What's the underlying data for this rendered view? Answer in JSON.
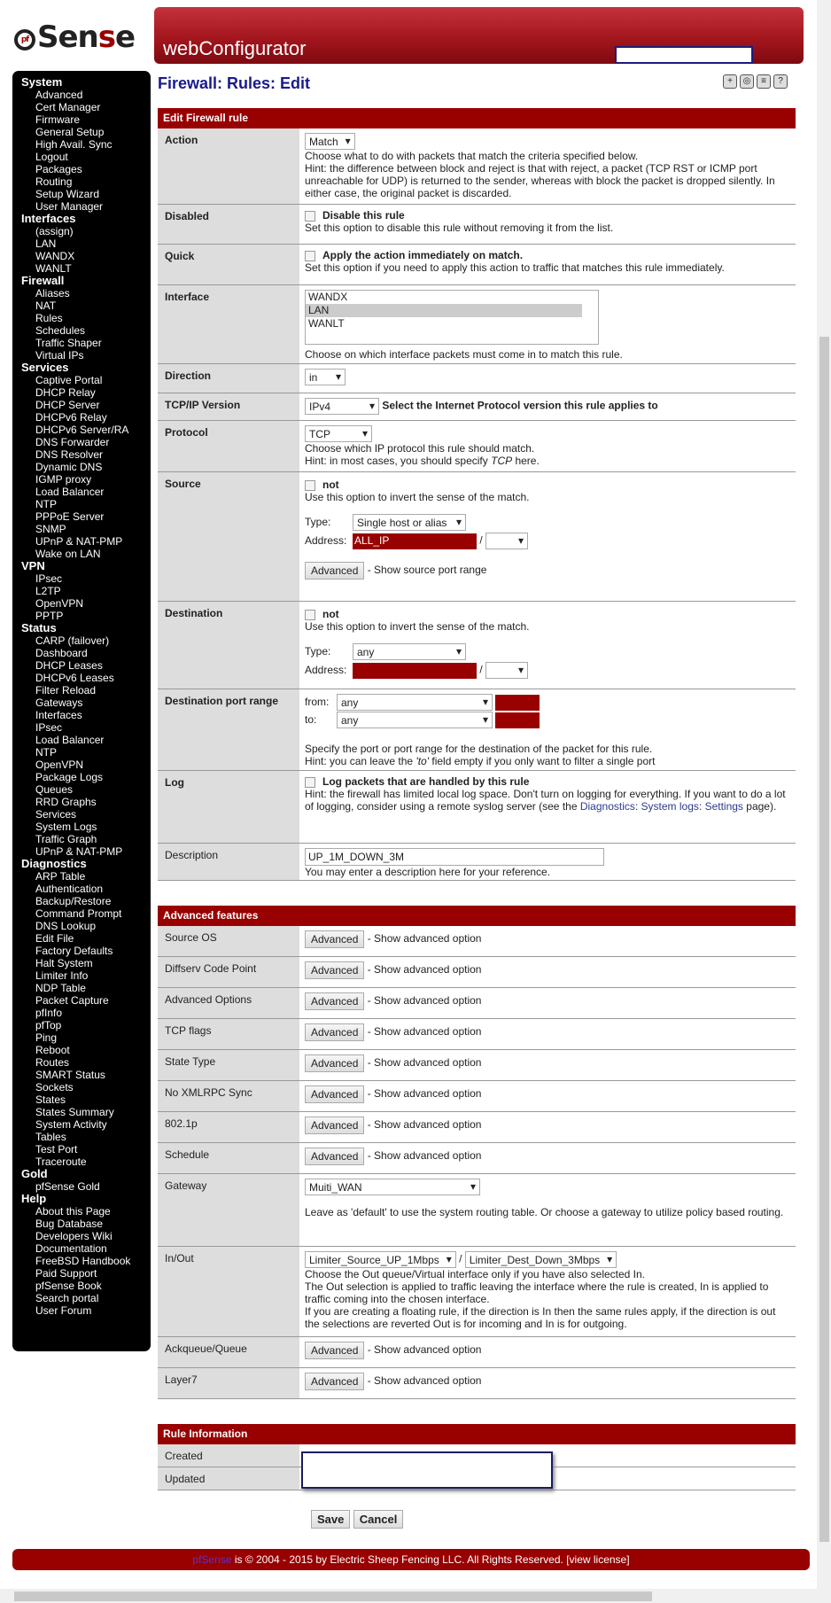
{
  "brand": {
    "logo": "pfSense",
    "app": "webConfigurator"
  },
  "page_title": "Firewall: Rules: Edit",
  "sidebar": [
    {
      "h": "System",
      "items": [
        "Advanced",
        "Cert Manager",
        "Firmware",
        "General Setup",
        "High Avail. Sync",
        "Logout",
        "Packages",
        "Routing",
        "Setup Wizard",
        "User Manager"
      ]
    },
    {
      "h": "Interfaces",
      "items": [
        "(assign)",
        "LAN",
        "WANDX",
        "WANLT"
      ]
    },
    {
      "h": "Firewall",
      "items": [
        "Aliases",
        "NAT",
        "Rules",
        "Schedules",
        "Traffic Shaper",
        "Virtual IPs"
      ]
    },
    {
      "h": "Services",
      "items": [
        "Captive Portal",
        "DHCP Relay",
        "DHCP Server",
        "DHCPv6 Relay",
        "DHCPv6 Server/RA",
        "DNS Forwarder",
        "DNS Resolver",
        "Dynamic DNS",
        "IGMP proxy",
        "Load Balancer",
        "NTP",
        "PPPoE Server",
        "SNMP",
        "UPnP & NAT-PMP",
        "Wake on LAN"
      ]
    },
    {
      "h": "VPN",
      "items": [
        "IPsec",
        "L2TP",
        "OpenVPN",
        "PPTP"
      ]
    },
    {
      "h": "Status",
      "items": [
        "CARP (failover)",
        "Dashboard",
        "DHCP Leases",
        "DHCPv6 Leases",
        "Filter Reload",
        "Gateways",
        "Interfaces",
        "IPsec",
        "Load Balancer",
        "NTP",
        "OpenVPN",
        "Package Logs",
        "Queues",
        "RRD Graphs",
        "Services",
        "System Logs",
        "Traffic Graph",
        "UPnP & NAT-PMP"
      ]
    },
    {
      "h": "Diagnostics",
      "items": [
        "ARP Table",
        "Authentication",
        "Backup/Restore",
        "Command Prompt",
        "DNS Lookup",
        "Edit File",
        "Factory Defaults",
        "Halt System",
        "Limiter Info",
        "NDP Table",
        "Packet Capture",
        "pfInfo",
        "pfTop",
        "Ping",
        "Reboot",
        "Routes",
        "SMART Status",
        "Sockets",
        "States",
        "States Summary",
        "System Activity",
        "Tables",
        "Test Port",
        "Traceroute"
      ]
    },
    {
      "h": "Gold",
      "items": [
        "pfSense Gold"
      ]
    },
    {
      "h": "Help",
      "items": [
        "About this Page",
        "Bug Database",
        "Developers Wiki",
        "Documentation",
        "FreeBSD Handbook",
        "Paid Support",
        "pfSense Book",
        "Search portal",
        "User Forum"
      ]
    }
  ],
  "edit": {
    "header": "Edit Firewall rule",
    "action": {
      "label": "Action",
      "value": "Match",
      "help1": "Choose what to do with packets that match the criteria specified below.",
      "help2": "Hint: the difference between block and reject is that with reject, a packet (TCP RST or ICMP port unreachable for UDP) is returned to the sender, whereas with block the packet is dropped silently. In either case, the original packet is discarded."
    },
    "disabled": {
      "label": "Disabled",
      "checkbox": "Disable this rule",
      "help": "Set this option to disable this rule without removing it from the list.",
      "checked": false
    },
    "quick": {
      "label": "Quick",
      "checkbox": "Apply the action immediately on match.",
      "help": "Set this option if you need to apply this action to traffic that matches this rule immediately.",
      "checked": false
    },
    "interface": {
      "label": "Interface",
      "options": [
        "WANDX",
        "LAN",
        "WANLT"
      ],
      "selected": "LAN",
      "help": "Choose on which interface packets must come in to match this rule."
    },
    "direction": {
      "label": "Direction",
      "value": "in"
    },
    "ipver": {
      "label": "TCP/IP Version",
      "value": "IPv4",
      "help": "Select the Internet Protocol version this rule applies to"
    },
    "protocol": {
      "label": "Protocol",
      "value": "TCP",
      "help1": "Choose which IP protocol this rule should match.",
      "help2a": "Hint: in most cases, you should specify",
      "help2b": "TCP",
      "help2c": "here."
    },
    "source": {
      "label": "Source",
      "not": "not",
      "help": "Use this option to invert the sense of the match.",
      "type_label": "Type:",
      "type": "Single host or alias",
      "addr_label": "Address:",
      "addr": "ALL_IP",
      "slash": "/",
      "adv_button": "Advanced",
      "adv_text": "- Show source port range"
    },
    "destination": {
      "label": "Destination",
      "not": "not",
      "help": "Use this option to invert the sense of the match.",
      "type_label": "Type:",
      "type": "any",
      "addr_label": "Address:",
      "addr": "",
      "slash": "/"
    },
    "dport": {
      "label": "Destination port range",
      "from_label": "from:",
      "from": "any",
      "to_label": "to:",
      "to": "any",
      "help1": "Specify the port or port range for the destination of the packet for this rule.",
      "help2a": "Hint: you can leave the",
      "help2b": "'to'",
      "help2c": "field empty if you only want to filter a single port"
    },
    "log": {
      "label": "Log",
      "checkbox": "Log packets that are handled by this rule",
      "help_a": "Hint: the firewall has limited local log space. Don't turn on logging for everything. If you want to do a lot of logging, consider using a remote syslog server (see the",
      "link": "Diagnostics: System logs: Settings",
      "help_b": "page)."
    },
    "description": {
      "label": "Description",
      "value": "UP_1M_DOWN_3M",
      "help": "You may enter a description here for your reference."
    }
  },
  "advanced": {
    "header": "Advanced features",
    "button": "Advanced",
    "text": "- Show advanced option",
    "rows": [
      "Source OS",
      "Diffserv Code Point",
      "Advanced Options",
      "TCP flags",
      "State Type",
      "No XMLRPC Sync",
      "802.1p",
      "Schedule"
    ],
    "gateway": {
      "label": "Gateway",
      "value": "Muiti_WAN",
      "help": "Leave as 'default' to use the system routing table. Or choose a gateway to utilize policy based routing."
    },
    "inout": {
      "label": "In/Out",
      "in": "Limiter_Source_UP_1Mbps",
      "slash": "/",
      "out": "Limiter_Dest_Down_3Mbps",
      "help1": "Choose the Out queue/Virtual interface only if you have also selected In.",
      "help2": "The Out selection is applied to traffic leaving the interface where the rule is created, In is applied to traffic coming into the chosen interface.",
      "help3": "If you are creating a floating rule, if the direction is In then the same rules apply, if the direction is out the selections are reverted Out is for incoming and In is for outgoing."
    },
    "rows2": [
      "Ackqueue/Queue",
      "Layer7"
    ]
  },
  "info": {
    "header": "Rule Information",
    "created": "Created",
    "updated": "Updated"
  },
  "buttons": {
    "save": "Save",
    "cancel": "Cancel"
  },
  "footer": {
    "brand": "pfSense",
    "text": "is © 2004 - 2015 by Electric Sheep Fencing LLC. All Rights Reserved.",
    "license": "[view license]"
  }
}
